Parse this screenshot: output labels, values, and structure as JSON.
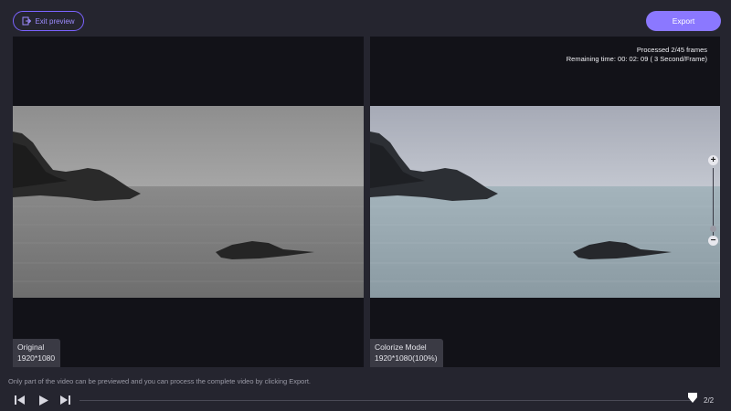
{
  "toolbar": {
    "exit_label": "Exit preview",
    "export_label": "Export"
  },
  "left_panel": {
    "title": "Original",
    "resolution": "1920*1080"
  },
  "right_panel": {
    "title": "Colorize Model",
    "resolution": "1920*1080(100%)",
    "processed": "Processed 2/45 frames",
    "remaining": "Remaining time: 00: 02: 09 ( 3 Second/Frame)"
  },
  "footer": {
    "notice": "Only part of the video can be previewed and you can process the complete video by clicking Export.",
    "frame_counter": "2/2"
  },
  "icons": {
    "exit": "exit-icon",
    "zoom_in": "zoom-in-icon",
    "zoom_out": "zoom-out-icon",
    "prev": "previous-frame-icon",
    "play": "play-icon",
    "next": "next-frame-icon",
    "handle": "timeline-handle-icon"
  },
  "colors": {
    "accent": "#8b78ff",
    "background": "#25252f",
    "panel": "#121218"
  }
}
